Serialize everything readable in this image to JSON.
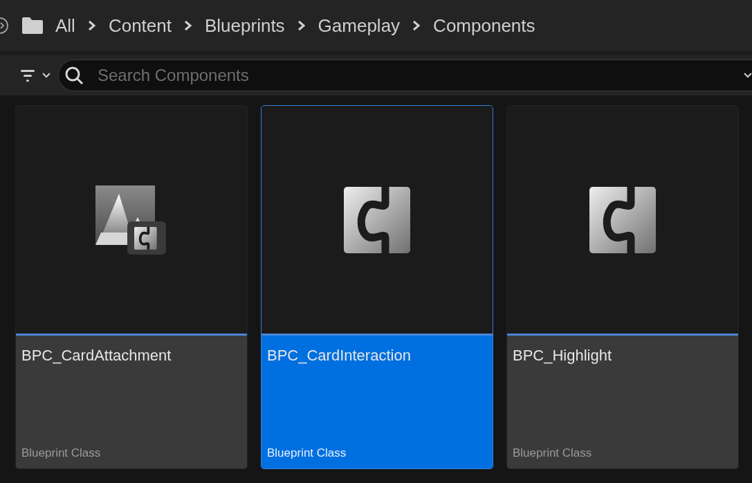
{
  "breadcrumb": [
    "All",
    "Content",
    "Blueprints",
    "Gameplay",
    "Components"
  ],
  "search": {
    "placeholder": "Search Components"
  },
  "assets": [
    {
      "name": "BPC_CardAttachment",
      "type": "Blueprint Class",
      "selected": false,
      "kind": "asset-component"
    },
    {
      "name": "BPC_CardInteraction",
      "type": "Blueprint Class",
      "selected": true,
      "kind": "component"
    },
    {
      "name": "BPC_Highlight",
      "type": "Blueprint Class",
      "selected": false,
      "kind": "component"
    }
  ]
}
